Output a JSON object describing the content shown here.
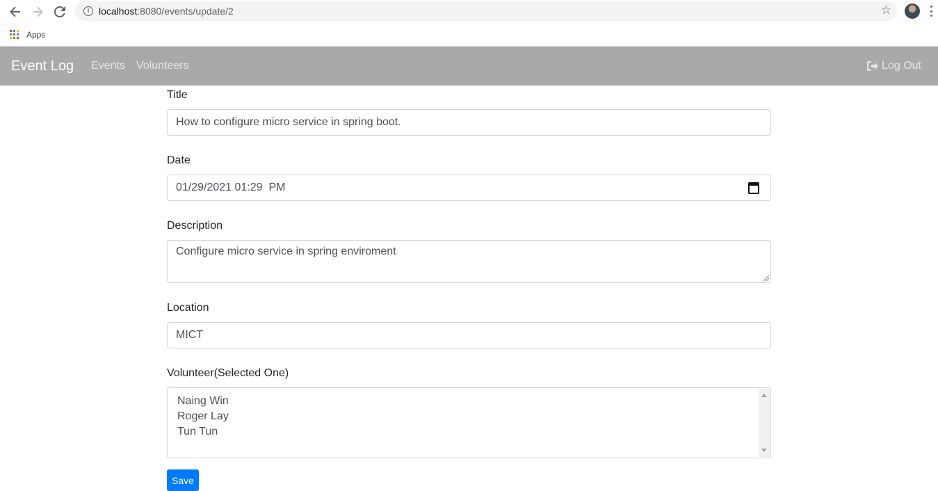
{
  "browser": {
    "url_host": "localhost",
    "url_path": ":8080/events/update/2",
    "bookmark_apps": "Apps"
  },
  "navbar": {
    "brand": "Event Log",
    "links": [
      "Events",
      "Volunteers"
    ],
    "logout": "Log Out"
  },
  "form": {
    "title_label": "Title",
    "title_value": "How to configure micro service in spring boot.",
    "date_label": "Date",
    "date_value": "01/29/2021 01:29  PM",
    "description_label": "Description",
    "description_value": "Configure micro service in spring enviroment",
    "location_label": "Location",
    "location_value": "MICT",
    "volunteer_label": "Volunteer(Selected One)",
    "volunteers": [
      "Naing Win",
      "Roger Lay",
      "Tun Tun"
    ],
    "save_label": "Save"
  },
  "colors": {
    "navbar": "#a9a9a9",
    "primary": "#007bff"
  }
}
